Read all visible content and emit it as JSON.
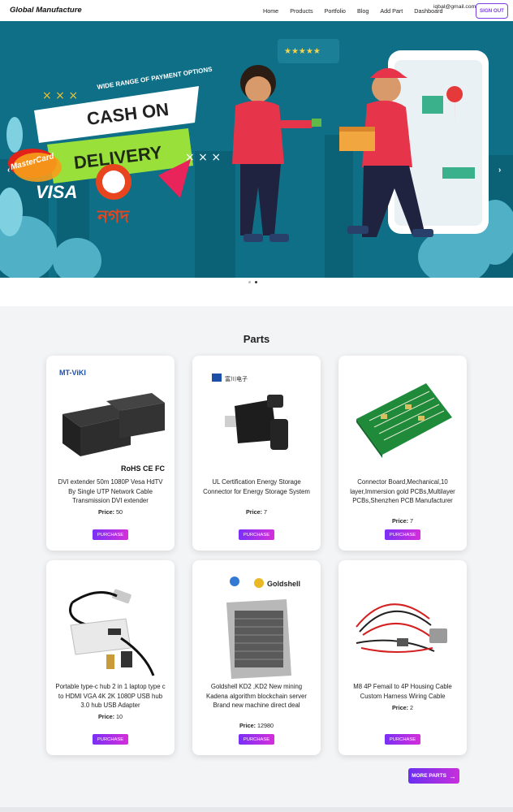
{
  "header": {
    "brand": "Global Manufacture",
    "nav": [
      "Home",
      "Products",
      "Portfolio",
      "Blog",
      "Add Part",
      "Dashboard"
    ],
    "email": "iqbal@gmail.com",
    "signout": "SIGN OUT"
  },
  "hero": {
    "tagline": "WIDE RANGE OF PAYMENT OPTIONS",
    "headline_1": "CASH ON",
    "headline_2": "DELIVERY",
    "payments": [
      "MasterCard",
      "VISA",
      "নগদ"
    ],
    "prev": "‹",
    "next": "›"
  },
  "parts": {
    "title": "Parts",
    "price_label": "Price:",
    "purchase_label": "PURCHASE",
    "items": [
      {
        "name": "DVI extender 50m 1080P Vesa HdTV By Single UTP Network Cable Transmission DVI extender",
        "price": "50",
        "brand": "MT-ViKI",
        "marks": "RoHS CE FC"
      },
      {
        "name": "UL Certification Energy Storage Connector for Energy Storage System",
        "price": "7",
        "brand": "富川电子"
      },
      {
        "name": "Connector Board,Mechanical,10 layer,Immersion gold PCBs,Multilayer PCBs,Shenzhen PCB Manufacturer",
        "price": "7"
      },
      {
        "name": "Portable type-c hub 2 in 1 laptop type c to HDMI VGA 4K 2K 1080P USB hub 3.0 hub USB Adapter",
        "price": "10"
      },
      {
        "name": "Goldshell KD2 ,KD2 New mining Kadena algorithm blockchain server Brand new machine direct deal",
        "price": "12980",
        "brand": "Goldshell"
      },
      {
        "name": "M8 4P Femail to 4P Housing Cable Custom Harness Wiring Cable",
        "price": "2"
      }
    ]
  },
  "more_button": "MORE PARTS",
  "colors": {
    "accent": "#7b2ff7",
    "hero_bg": "#0e6f86"
  }
}
